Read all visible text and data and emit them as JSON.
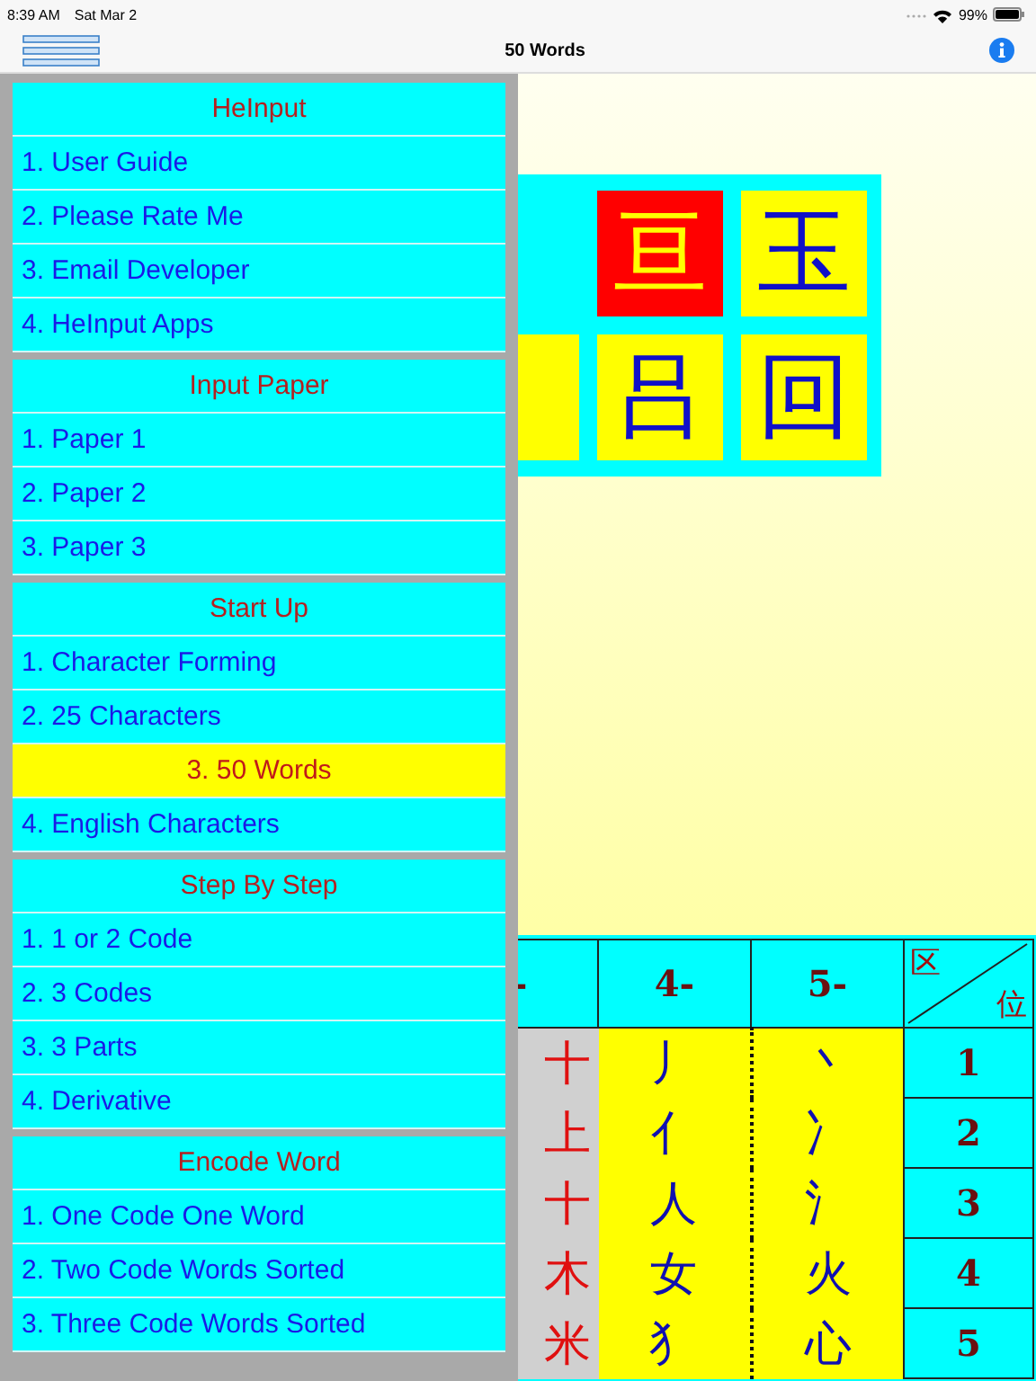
{
  "status_bar": {
    "time": "8:39 AM",
    "date": "Sat Mar 2",
    "battery": "99%"
  },
  "nav": {
    "title": "50 Words"
  },
  "drawer": {
    "sections": [
      {
        "title": "HeInput",
        "items": [
          {
            "label": "1. User Guide",
            "selected": false
          },
          {
            "label": "2. Please Rate Me",
            "selected": false
          },
          {
            "label": "3. Email Developer",
            "selected": false
          },
          {
            "label": "4. HeInput Apps",
            "selected": false
          }
        ]
      },
      {
        "title": "Input Paper",
        "items": [
          {
            "label": "1. Paper 1",
            "selected": false
          },
          {
            "label": "2. Paper 2",
            "selected": false
          },
          {
            "label": "3. Paper 3",
            "selected": false
          }
        ]
      },
      {
        "title": "Start Up",
        "items": [
          {
            "label": "1. Character Forming",
            "selected": false
          },
          {
            "label": "2. 25 Characters",
            "selected": false
          },
          {
            "label": "3. 50 Words",
            "selected": true
          },
          {
            "label": "4. English Characters",
            "selected": false
          }
        ]
      },
      {
        "title": "Step By Step",
        "items": [
          {
            "label": "1. 1 or 2 Code",
            "selected": false
          },
          {
            "label": "2. 3 Codes",
            "selected": false
          },
          {
            "label": "3. 3 Parts",
            "selected": false
          },
          {
            "label": "4. Derivative",
            "selected": false
          }
        ]
      },
      {
        "title": "Encode Word",
        "items": [
          {
            "label": "1. One Code One Word",
            "selected": false
          },
          {
            "label": "2. Two Code Words Sorted",
            "selected": false
          },
          {
            "label": "3. Three Code Words Sorted",
            "selected": false
          }
        ]
      }
    ]
  },
  "char_grid": {
    "cells": [
      {
        "kind": "dimmed"
      },
      {
        "char": "亘",
        "kind": "highlighted"
      },
      {
        "char": "玉",
        "kind": "normal"
      },
      {
        "kind": "normal"
      },
      {
        "char": "吕",
        "kind": "normal"
      },
      {
        "char": "回",
        "kind": "normal"
      }
    ]
  },
  "code_table": {
    "columns": [
      "-",
      "4-",
      "5-"
    ],
    "corner": {
      "top": "区",
      "bottom": "位"
    },
    "rows": [
      {
        "column_1": "十",
        "column_2": "丿",
        "column_3": "丶",
        "number": "1"
      },
      {
        "column_1": "上",
        "column_2": "亻",
        "column_3": "冫",
        "number": "2"
      },
      {
        "column_1": "十",
        "column_2": "人",
        "column_3": "氵",
        "number": "3"
      },
      {
        "column_1": "木",
        "column_2": "女",
        "column_3": "火",
        "number": "4"
      },
      {
        "column_1": "米",
        "column_2": "犭",
        "column_3": "心",
        "number": "5"
      }
    ]
  }
}
